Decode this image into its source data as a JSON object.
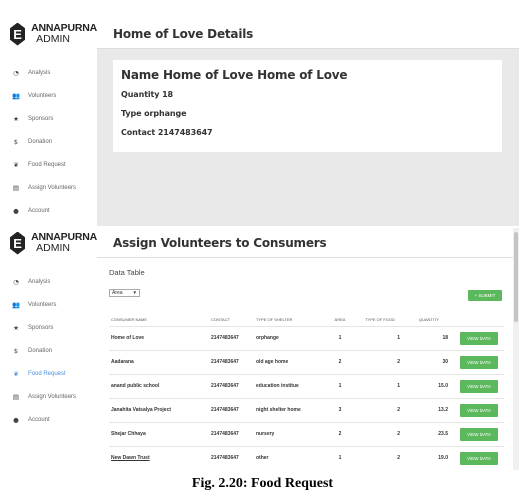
{
  "brand": {
    "letter": "E",
    "name": "ANNAPURNA",
    "sub": "ADMIN"
  },
  "nav": [
    {
      "label": "Analysis",
      "icon": "dashboard-icon",
      "glyph": "◔"
    },
    {
      "label": "Volunteers",
      "icon": "users-icon",
      "glyph": "👥"
    },
    {
      "label": "Sponsors",
      "icon": "star-icon",
      "glyph": "★"
    },
    {
      "label": "Donation",
      "icon": "dollar-icon",
      "glyph": "$"
    },
    {
      "label": "Food Request",
      "icon": "leaf-icon",
      "glyph": "❦"
    },
    {
      "label": "Assign Volunteers",
      "icon": "assign-icon",
      "glyph": "▤"
    },
    {
      "label": "Account",
      "icon": "user-icon",
      "glyph": "●"
    }
  ],
  "panel1": {
    "header": "Home of Love Details",
    "details": {
      "name": "Name Home of Love Home of Love",
      "quantity": "Quantity 18",
      "type": "Type orphange",
      "contact": "Contact 2147483647"
    }
  },
  "panel2": {
    "header": "Assign Volunteers to Consumers",
    "active_nav": "Food Request",
    "data_table_title": "Data Table",
    "filter_value": "Area",
    "submit_label": "+ SUBMIT",
    "columns": [
      "CONSUMER NAME",
      "CONTACT",
      "TYPE OF SHELTER",
      "AREA",
      "TYPE OF FOOD",
      "QUANTITY",
      ""
    ],
    "view_label": "VIEW DATA",
    "rows": [
      [
        "Home of Love",
        "2147483647",
        "orphange",
        "1",
        "1",
        "18"
      ],
      [
        "Aadarana",
        "2147483647",
        "old age home",
        "2",
        "2",
        "30"
      ],
      [
        "anand public school",
        "2147483647",
        "education institue",
        "1",
        "1",
        "15.0"
      ],
      [
        "Janahita Vatsalya Project",
        "2147483647",
        "night shelter home",
        "3",
        "2",
        "13.2"
      ],
      [
        "Shejar Chhaya",
        "2147483647",
        "nursery",
        "2",
        "2",
        "23.5"
      ],
      [
        "New Dawn Trust",
        "2147483647",
        "other",
        "1",
        "2",
        "19.0"
      ]
    ]
  },
  "caption": "Fig. 2.20: Food Request",
  "colors": {
    "accent_green": "#5cb85c",
    "active_blue": "#4a90d9",
    "panel_bg": "#e9e9ea"
  }
}
